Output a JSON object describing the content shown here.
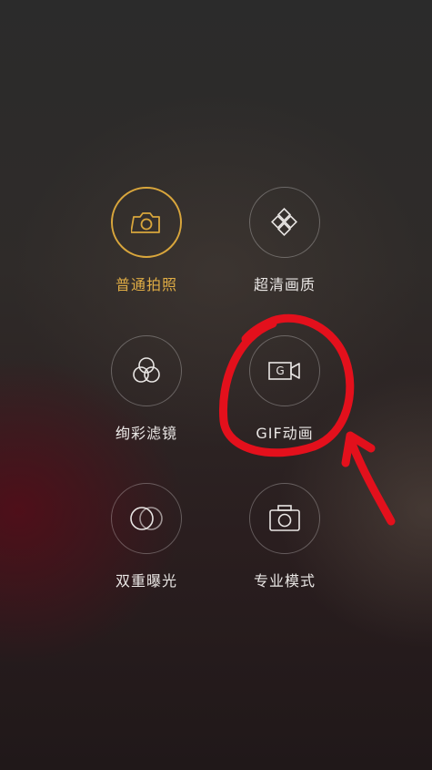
{
  "modes": [
    {
      "label": "普通拍照",
      "icon": "camera-icon",
      "active": true
    },
    {
      "label": "超清画质",
      "icon": "diamond-grid-icon",
      "active": false
    },
    {
      "label": "绚彩滤镜",
      "icon": "color-filter-icon",
      "active": false
    },
    {
      "label": "GIF动画",
      "icon": "gif-video-icon",
      "active": false
    },
    {
      "label": "双重曝光",
      "icon": "double-exposure-icon",
      "active": false
    },
    {
      "label": "专业模式",
      "icon": "pro-camera-icon",
      "active": false
    }
  ],
  "gif_icon_letter": "G",
  "colors": {
    "active_accent": "#d9a63c",
    "annotation": "#e3101c",
    "label_text": "#e9e6e4"
  }
}
